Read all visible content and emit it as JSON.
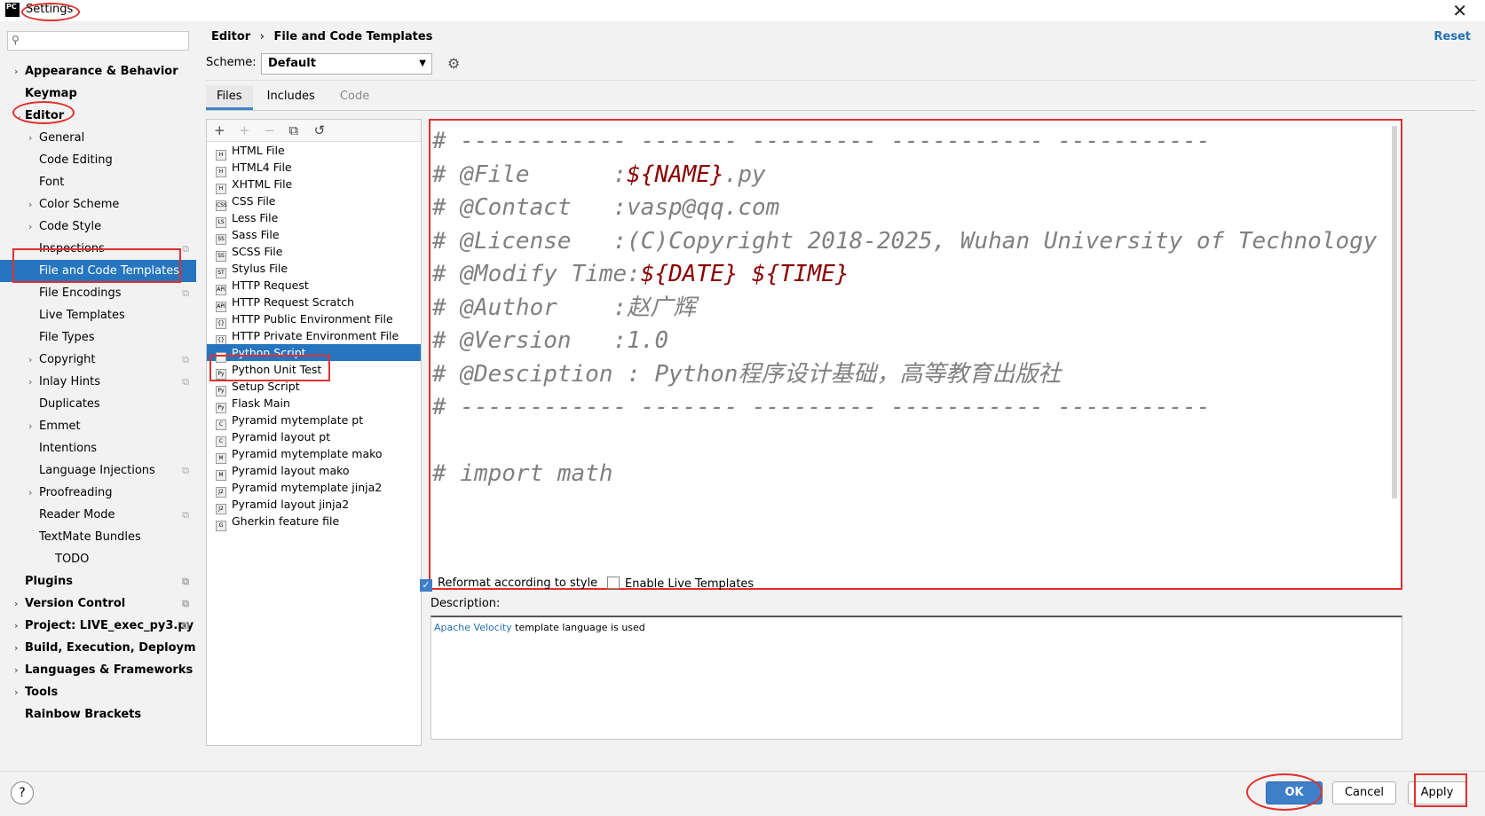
{
  "window": {
    "title": "Settings",
    "logo": "PC"
  },
  "search": {
    "placeholder": ""
  },
  "sidebar": {
    "items": [
      {
        "label": "Appearance & Behavior",
        "chevron": "›"
      },
      {
        "label": "Keymap"
      },
      {
        "label": "Editor",
        "chevron": "⌄"
      },
      {
        "label": "General",
        "chevron": "›"
      },
      {
        "label": "Code Editing"
      },
      {
        "label": "Font"
      },
      {
        "label": "Color Scheme",
        "chevron": "›"
      },
      {
        "label": "Code Style",
        "chevron": "›"
      },
      {
        "label": "Inspections"
      },
      {
        "label": "File and Code Templates"
      },
      {
        "label": "File Encodings"
      },
      {
        "label": "Live Templates"
      },
      {
        "label": "File Types"
      },
      {
        "label": "Copyright",
        "chevron": "›"
      },
      {
        "label": "Inlay Hints",
        "chevron": "›"
      },
      {
        "label": "Duplicates"
      },
      {
        "label": "Emmet",
        "chevron": "›"
      },
      {
        "label": "Intentions"
      },
      {
        "label": "Language Injections"
      },
      {
        "label": "Proofreading",
        "chevron": "›"
      },
      {
        "label": "Reader Mode"
      },
      {
        "label": "TextMate Bundles"
      },
      {
        "label": "TODO"
      },
      {
        "label": "Plugins"
      },
      {
        "label": "Version Control",
        "chevron": "›"
      },
      {
        "label": "Project: LIVE_exec_py3.py",
        "chevron": "›"
      },
      {
        "label": "Build, Execution, Deployment",
        "chevron": "›"
      },
      {
        "label": "Languages & Frameworks",
        "chevron": "›"
      },
      {
        "label": "Tools",
        "chevron": "›"
      },
      {
        "label": "Rainbow Brackets"
      }
    ]
  },
  "header": {
    "breadcrumb_1": "Editor",
    "breadcrumb_sep": "›",
    "breadcrumb_2": "File and Code Templates",
    "reset": "Reset"
  },
  "scheme": {
    "label": "Scheme:",
    "value": "Default"
  },
  "tabs": [
    {
      "label": "Files"
    },
    {
      "label": "Includes"
    },
    {
      "label": "Code"
    }
  ],
  "templates": [
    {
      "label": "HTML File",
      "icon": "H"
    },
    {
      "label": "HTML4 File",
      "icon": "H"
    },
    {
      "label": "XHTML File",
      "icon": "H"
    },
    {
      "label": "CSS File",
      "icon": "CSS"
    },
    {
      "label": "Less File",
      "icon": "LS"
    },
    {
      "label": "Sass File",
      "icon": "SS"
    },
    {
      "label": "SCSS File",
      "icon": "SS"
    },
    {
      "label": "Stylus File",
      "icon": "ST"
    },
    {
      "label": "HTTP Request",
      "icon": "API"
    },
    {
      "label": "HTTP Request Scratch",
      "icon": "API"
    },
    {
      "label": "HTTP Public Environment File",
      "icon": "{}"
    },
    {
      "label": "HTTP Private Environment File",
      "icon": "{}"
    },
    {
      "label": "Python Script",
      "icon": "Py"
    },
    {
      "label": "Python Unit Test",
      "icon": "Py"
    },
    {
      "label": "Setup Script",
      "icon": "Py"
    },
    {
      "label": "Flask Main",
      "icon": "Py"
    },
    {
      "label": "Pyramid mytemplate pt",
      "icon": "C"
    },
    {
      "label": "Pyramid layout pt",
      "icon": "C"
    },
    {
      "label": "Pyramid mytemplate mako",
      "icon": "M"
    },
    {
      "label": "Pyramid layout mako",
      "icon": "M"
    },
    {
      "label": "Pyramid mytemplate jinja2",
      "icon": "J2"
    },
    {
      "label": "Pyramid layout jinja2",
      "icon": "J2"
    },
    {
      "label": "Gherkin feature file",
      "icon": "G"
    }
  ],
  "toolbar": {
    "add": "+",
    "add_child": "+",
    "remove": "−",
    "copy": "⧉",
    "reset": "↺"
  },
  "code": {
    "lines": [
      [
        {
          "t": "# ------------ ------- --------- ----------- -----------"
        }
      ],
      [
        {
          "t": "# @File      :"
        },
        {
          "t": "${NAME}",
          "v": 1
        },
        {
          "t": ".py   "
        }
      ],
      [
        {
          "t": "# @Contact   :vasp@qq.com"
        }
      ],
      [
        {
          "t": "# @License   :(C)Copyright 2018-2025, Wuhan University of Technology"
        }
      ],
      [
        {
          "t": "# @Modify Time:"
        },
        {
          "t": "${DATE} ${TIME}",
          "v": 1
        }
      ],
      [
        {
          "t": "# @Author    :赵广辉"
        }
      ],
      [
        {
          "t": "# @Version   :1.0"
        }
      ],
      [
        {
          "t": "# @Desciption : Python程序设计基础，高等教育出版社"
        }
      ],
      [
        {
          "t": "# ------------ ------- --------- ----------- -----------"
        }
      ],
      [
        {
          "t": ""
        }
      ],
      [
        {
          "t": "# import math"
        }
      ]
    ]
  },
  "options": {
    "reformat": "Reformat according to style",
    "live": "Enable Live Templates"
  },
  "description": {
    "label": "Description:",
    "link": "Apache Velocity",
    "rest": " template language is used"
  },
  "buttons": {
    "help": "?",
    "ok": "OK",
    "cancel": "Cancel",
    "apply": "Apply"
  },
  "colors": {
    "accent": "#2675bf",
    "annotation": "#e03030",
    "template_var": "#8b0000"
  }
}
